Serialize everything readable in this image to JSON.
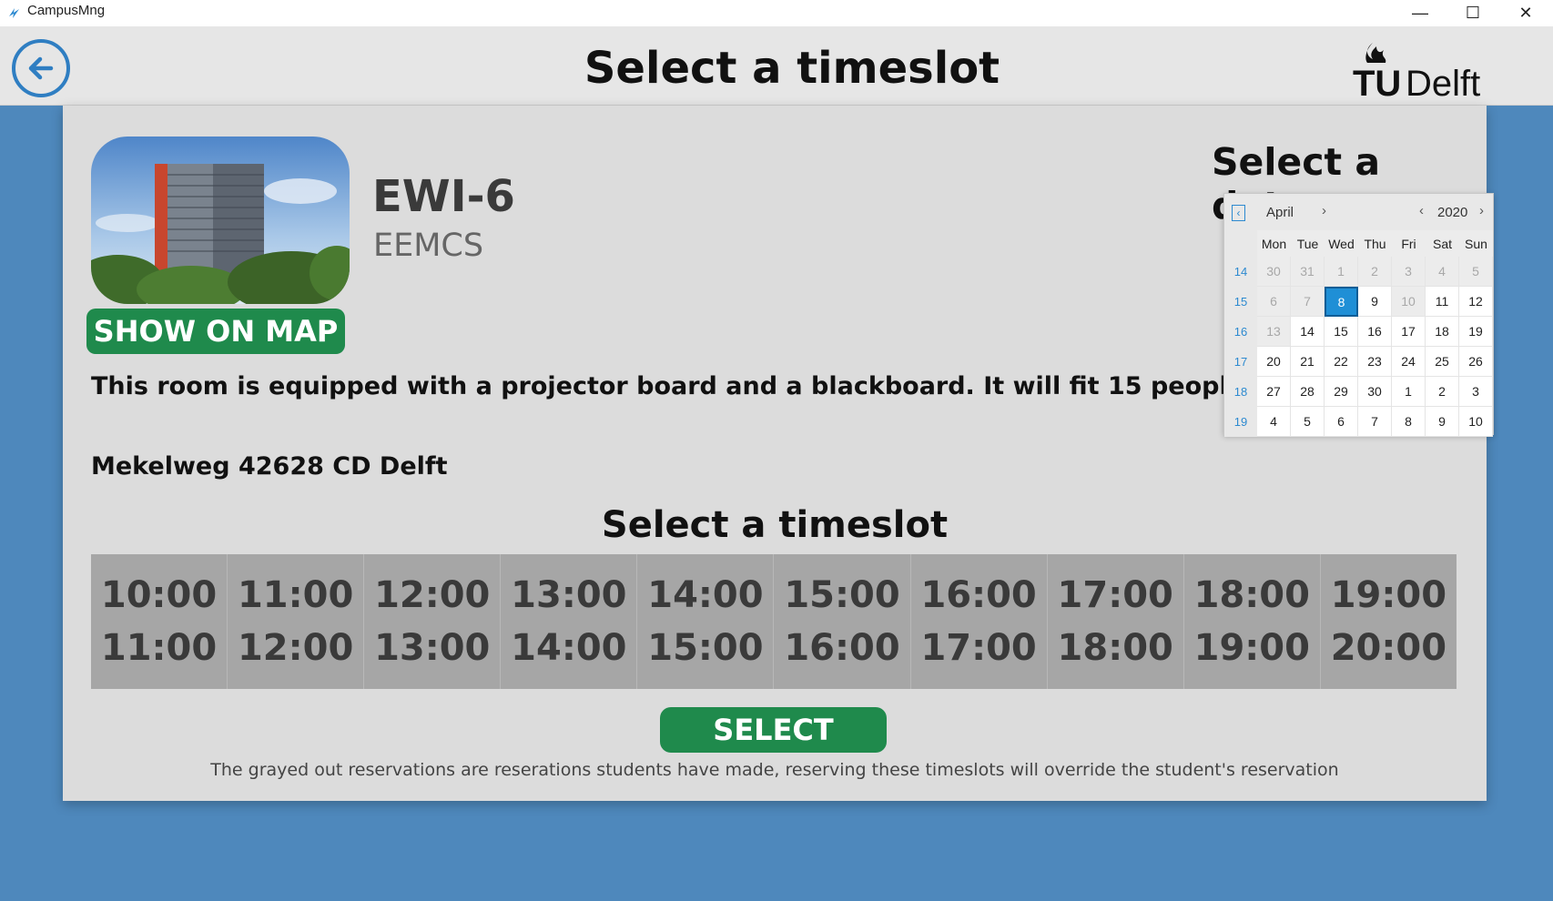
{
  "window": {
    "title": "CampusMng",
    "minimize": "—",
    "maximize": "☐",
    "close": "✕"
  },
  "header": {
    "title": "Select a timeslot",
    "logo": "TUDelft",
    "colors": {
      "back_button": "#2f7ec2"
    }
  },
  "room": {
    "name": "EWI-6",
    "building": "EEMCS",
    "map_button": "SHOW ON MAP",
    "description": "This room is equipped with a projector board and a blackboard. It will fit 15 people.",
    "address": "Mekelweg 42628 CD Delft"
  },
  "date": {
    "heading": "Select a date",
    "month": "April",
    "year": "2020",
    "weekday_headers": [
      "Mon",
      "Tue",
      "Wed",
      "Thu",
      "Fri",
      "Sat",
      "Sun"
    ],
    "selected_day": "8",
    "weeks": [
      {
        "week": "14",
        "days": [
          {
            "d": "30",
            "dis": true
          },
          {
            "d": "31",
            "dis": true
          },
          {
            "d": "1",
            "dis": true
          },
          {
            "d": "2",
            "dis": true
          },
          {
            "d": "3",
            "dis": true
          },
          {
            "d": "4",
            "dis": true
          },
          {
            "d": "5",
            "dis": true
          }
        ]
      },
      {
        "week": "15",
        "days": [
          {
            "d": "6",
            "dis": true
          },
          {
            "d": "7",
            "dis": true
          },
          {
            "d": "8",
            "sel": true
          },
          {
            "d": "9"
          },
          {
            "d": "10",
            "dis": true
          },
          {
            "d": "11"
          },
          {
            "d": "12"
          }
        ]
      },
      {
        "week": "16",
        "days": [
          {
            "d": "13",
            "dis": true
          },
          {
            "d": "14"
          },
          {
            "d": "15"
          },
          {
            "d": "16"
          },
          {
            "d": "17"
          },
          {
            "d": "18"
          },
          {
            "d": "19"
          }
        ]
      },
      {
        "week": "17",
        "days": [
          {
            "d": "20"
          },
          {
            "d": "21"
          },
          {
            "d": "22"
          },
          {
            "d": "23"
          },
          {
            "d": "24"
          },
          {
            "d": "25"
          },
          {
            "d": "26"
          }
        ]
      },
      {
        "week": "18",
        "days": [
          {
            "d": "27"
          },
          {
            "d": "28"
          },
          {
            "d": "29"
          },
          {
            "d": "30"
          },
          {
            "d": "1"
          },
          {
            "d": "2"
          },
          {
            "d": "3"
          }
        ]
      },
      {
        "week": "19",
        "days": [
          {
            "d": "4"
          },
          {
            "d": "5"
          },
          {
            "d": "6"
          },
          {
            "d": "7"
          },
          {
            "d": "8"
          },
          {
            "d": "9"
          },
          {
            "d": "10"
          }
        ]
      }
    ]
  },
  "timeslots": {
    "heading": "Select a timeslot",
    "slots": [
      {
        "start": "10:00",
        "end": "11:00"
      },
      {
        "start": "11:00",
        "end": "12:00"
      },
      {
        "start": "12:00",
        "end": "13:00"
      },
      {
        "start": "13:00",
        "end": "14:00"
      },
      {
        "start": "14:00",
        "end": "15:00"
      },
      {
        "start": "15:00",
        "end": "16:00"
      },
      {
        "start": "16:00",
        "end": "17:00"
      },
      {
        "start": "17:00",
        "end": "18:00"
      },
      {
        "start": "18:00",
        "end": "19:00"
      },
      {
        "start": "19:00",
        "end": "20:00"
      }
    ],
    "select_button": "SELECT",
    "note": "The grayed out reservations are reserations students have made, reserving these timeslots will override the student's reservation"
  },
  "icons": {
    "back": "back-arrow-icon",
    "app": "campusmng-app-icon"
  },
  "colors": {
    "accent_green": "#1f8a4c",
    "background_blue": "#4e88bc",
    "calendar_selected": "#1f8fd6"
  }
}
